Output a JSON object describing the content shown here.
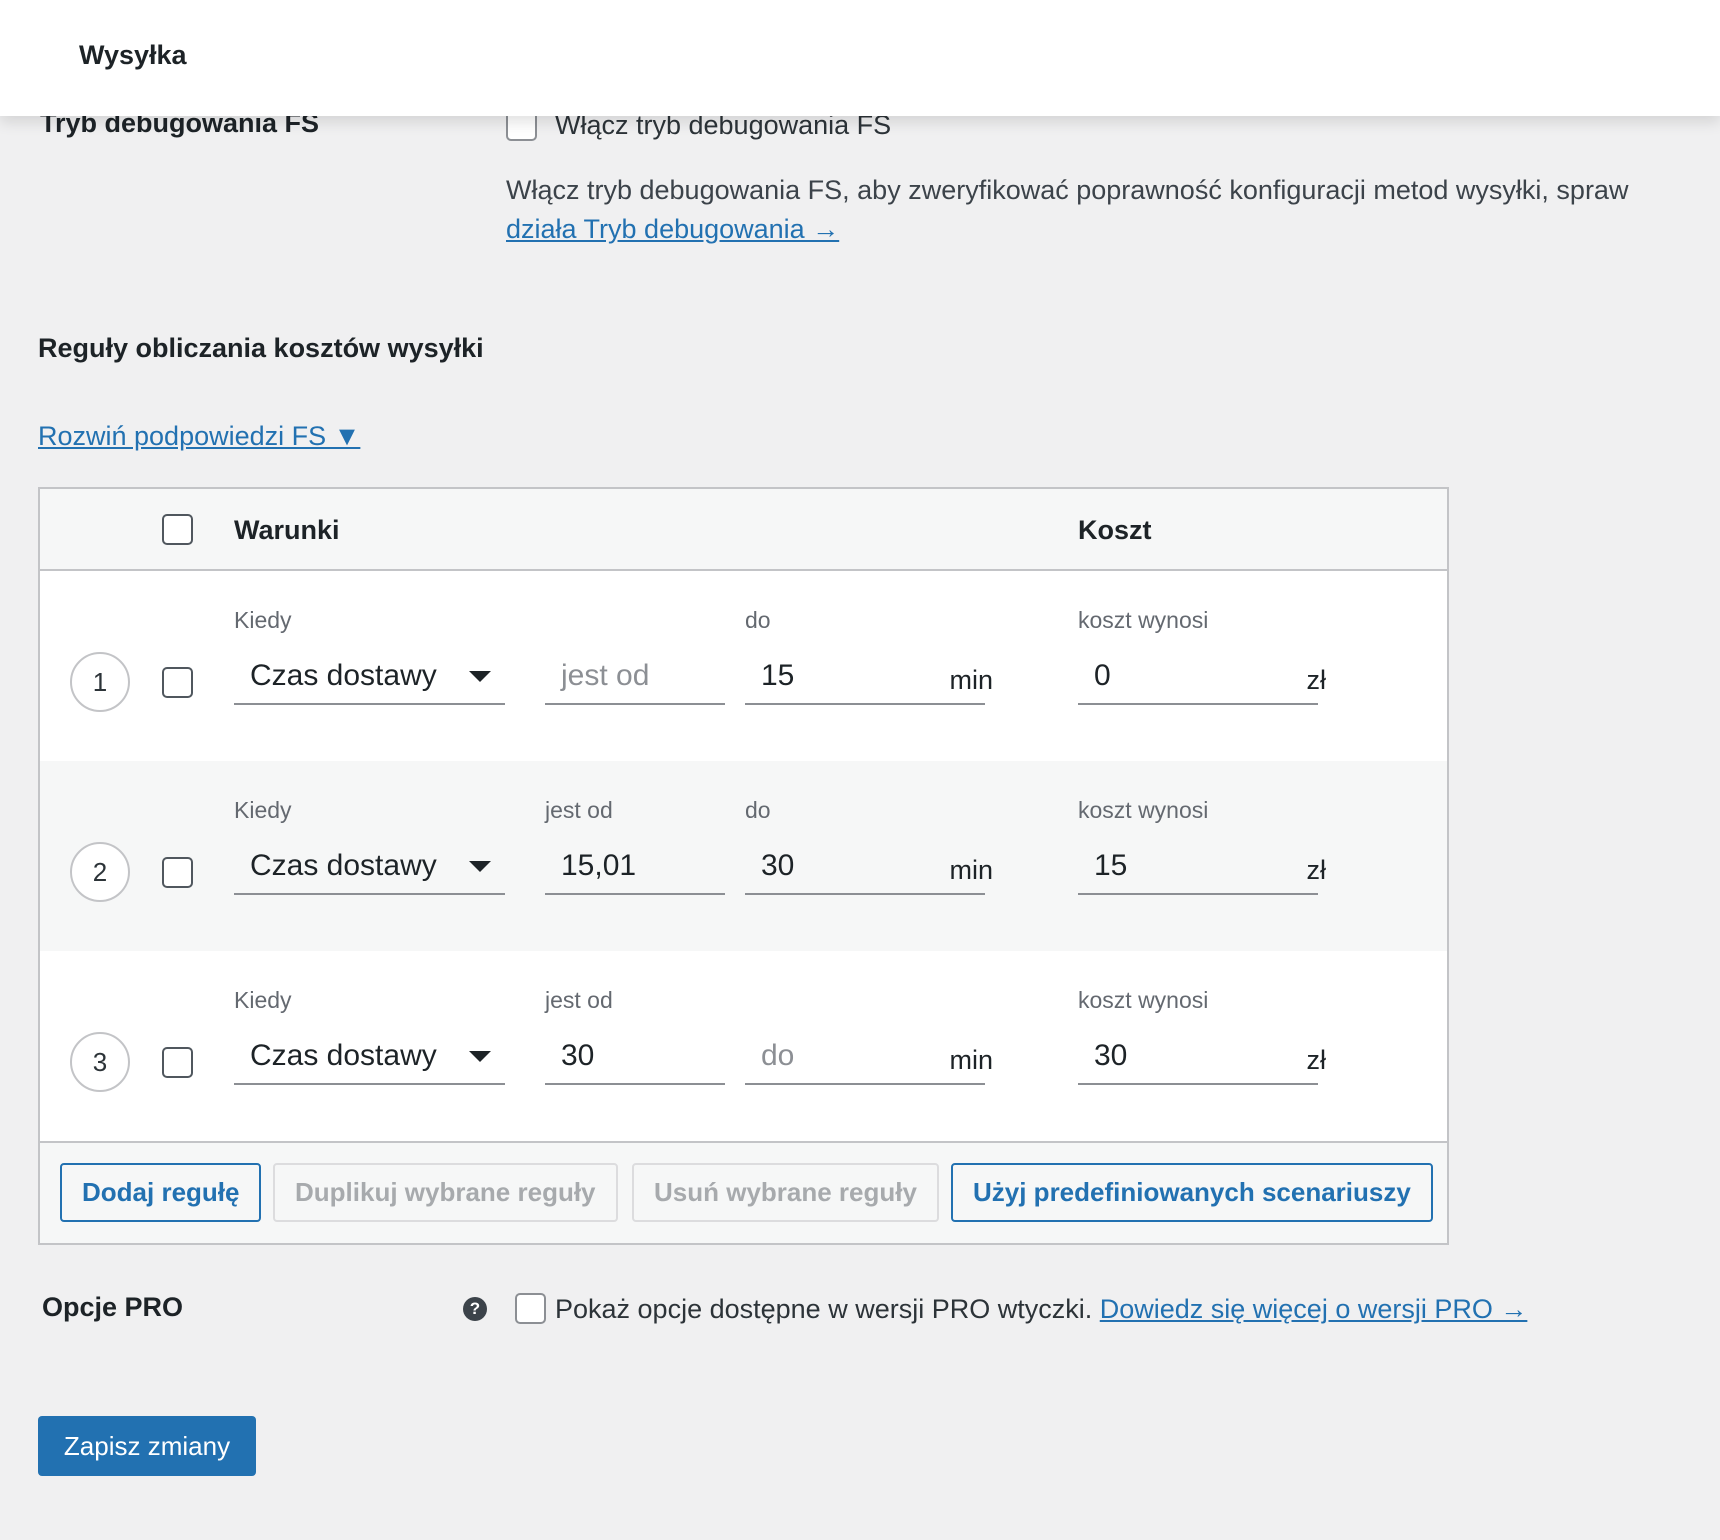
{
  "header": {
    "title": "Wysyłka"
  },
  "debug": {
    "label": "Tryb debugowania FS",
    "checkbox_label": "Włącz tryb debugowania FS",
    "description": "Włącz tryb debugowania FS, aby zweryfikować poprawność konfiguracji metod wysyłki, spraw",
    "link_text": "działa Tryb debugowania →"
  },
  "rules_section": {
    "title": "Reguły obliczania kosztów wysyłki",
    "expand_link": "Rozwiń podpowiedzi FS ▼",
    "columns": {
      "conditions": "Warunki",
      "cost": "Koszt"
    },
    "rows": [
      {
        "number": "1",
        "when_label": "Kiedy",
        "when_value": "Czas dostawy",
        "from_label": "",
        "from_value": "",
        "from_placeholder": "jest od",
        "to_label": "do",
        "to_value": "15",
        "to_placeholder": "",
        "unit": "min",
        "cost_label": "koszt wynosi",
        "cost_value": "0",
        "currency": "zł"
      },
      {
        "number": "2",
        "when_label": "Kiedy",
        "when_value": "Czas dostawy",
        "from_label": "jest od",
        "from_value": "15,01",
        "from_placeholder": "",
        "to_label": "do",
        "to_value": "30",
        "to_placeholder": "",
        "unit": "min",
        "cost_label": "koszt wynosi",
        "cost_value": "15",
        "currency": "zł"
      },
      {
        "number": "3",
        "when_label": "Kiedy",
        "when_value": "Czas dostawy",
        "from_label": "jest od",
        "from_value": "30",
        "from_placeholder": "",
        "to_label": "",
        "to_value": "",
        "to_placeholder": "do",
        "unit": "min",
        "cost_label": "koszt wynosi",
        "cost_value": "30",
        "currency": "zł"
      }
    ],
    "buttons": {
      "add": "Dodaj regułę",
      "duplicate": "Duplikuj wybrane reguły",
      "delete": "Usuń wybrane reguły",
      "predefined": "Użyj predefiniowanych scenariuszy"
    }
  },
  "pro_options": {
    "label": "Opcje PRO",
    "help_icon": "?",
    "checkbox_label": "Pokaż opcje dostępne w wersji PRO wtyczki.",
    "link_text": "Dowiedz się więcej o wersji PRO →"
  },
  "save_button": "Zapisz zmiany",
  "colors": {
    "accent": "#2271b1",
    "background": "#f0f0f1",
    "border": "#c3c4c7"
  }
}
